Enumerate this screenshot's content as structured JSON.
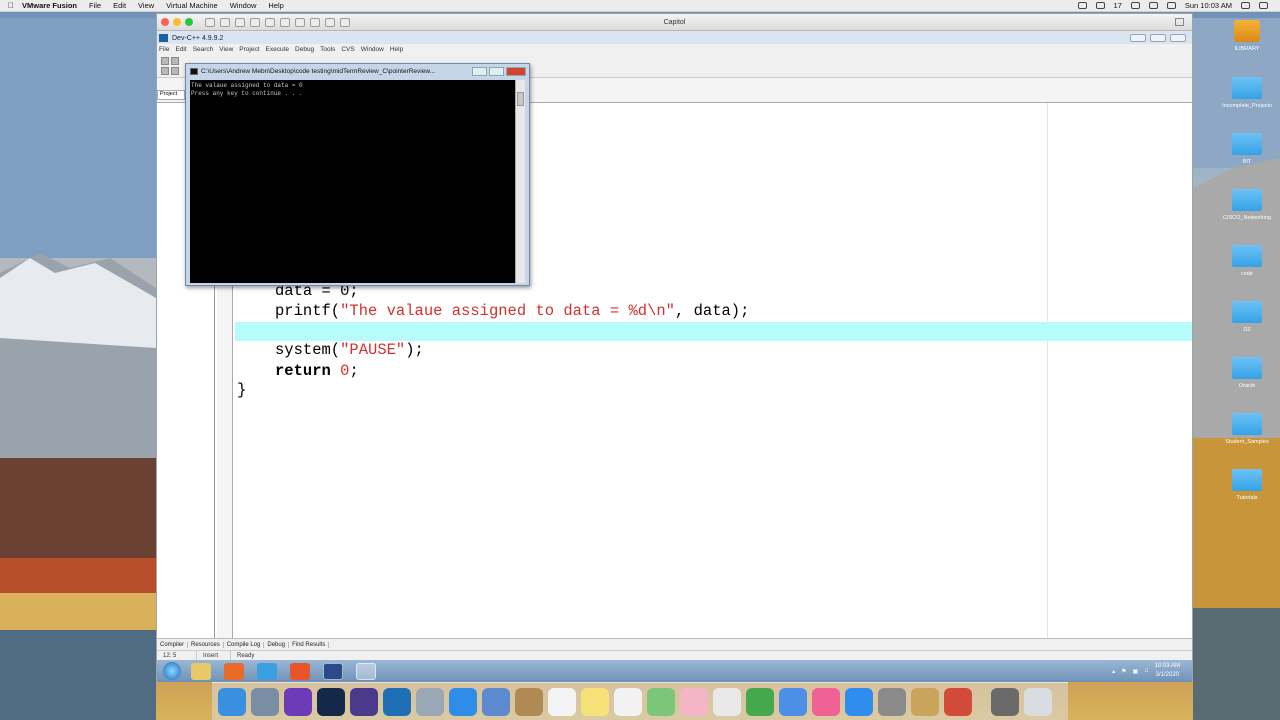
{
  "mac_menubar": {
    "app_name": "VMware Fusion",
    "menus": [
      "File",
      "Edit",
      "View",
      "Virtual Machine",
      "Window",
      "Help"
    ],
    "battery_count": "17",
    "clock": "Sun 10:03 AM"
  },
  "vm_window": {
    "title": "Capitol"
  },
  "devcpp": {
    "title": "Dev-C++ 4.9.9.2",
    "menus": [
      "File",
      "Edit",
      "Search",
      "View",
      "Project",
      "Execute",
      "Debug",
      "Tools",
      "CVS",
      "Window",
      "Help"
    ],
    "left_tab": "Project",
    "code_lines": {
      "l1": "data = 0;",
      "l2_fn": "printf(",
      "l2_str": "\"The valaue assigned to data = %d\\n\"",
      "l2_rest": ", data);",
      "l3_fn": "system(",
      "l3_str": "\"PAUSE\"",
      "l3_rest": ");",
      "l4_kw": "return",
      "l4_num": "0",
      "l4_rest": ";",
      "l5": "}"
    },
    "bottom_tabs": [
      "Compiler",
      "Resources",
      "Compile Log",
      "Debug",
      "Find Results"
    ],
    "status": {
      "position": "12: 5",
      "mode": "Insert",
      "state": "Ready"
    }
  },
  "console": {
    "title": "C:\\Users\\Andrew Mebn\\Desktop\\code testing\\midTermReview_C\\pointerReview...",
    "line1": "The valaue assigned to data = 0",
    "line2": "Press any key to continue . . ."
  },
  "win_taskbar": {
    "time": "10:03 AM",
    "date": "3/1/2020"
  },
  "desktop_icons": [
    "ILIBRARY",
    "Incomplete_Projects",
    "BIT",
    "CISCO_Networking",
    "code",
    "DZ",
    "Oracle",
    "Student_Samples",
    "Tutorials"
  ],
  "colors": {
    "string": "#d3312e",
    "active_line": "#b6fcfc",
    "console_bg": "#000000"
  }
}
